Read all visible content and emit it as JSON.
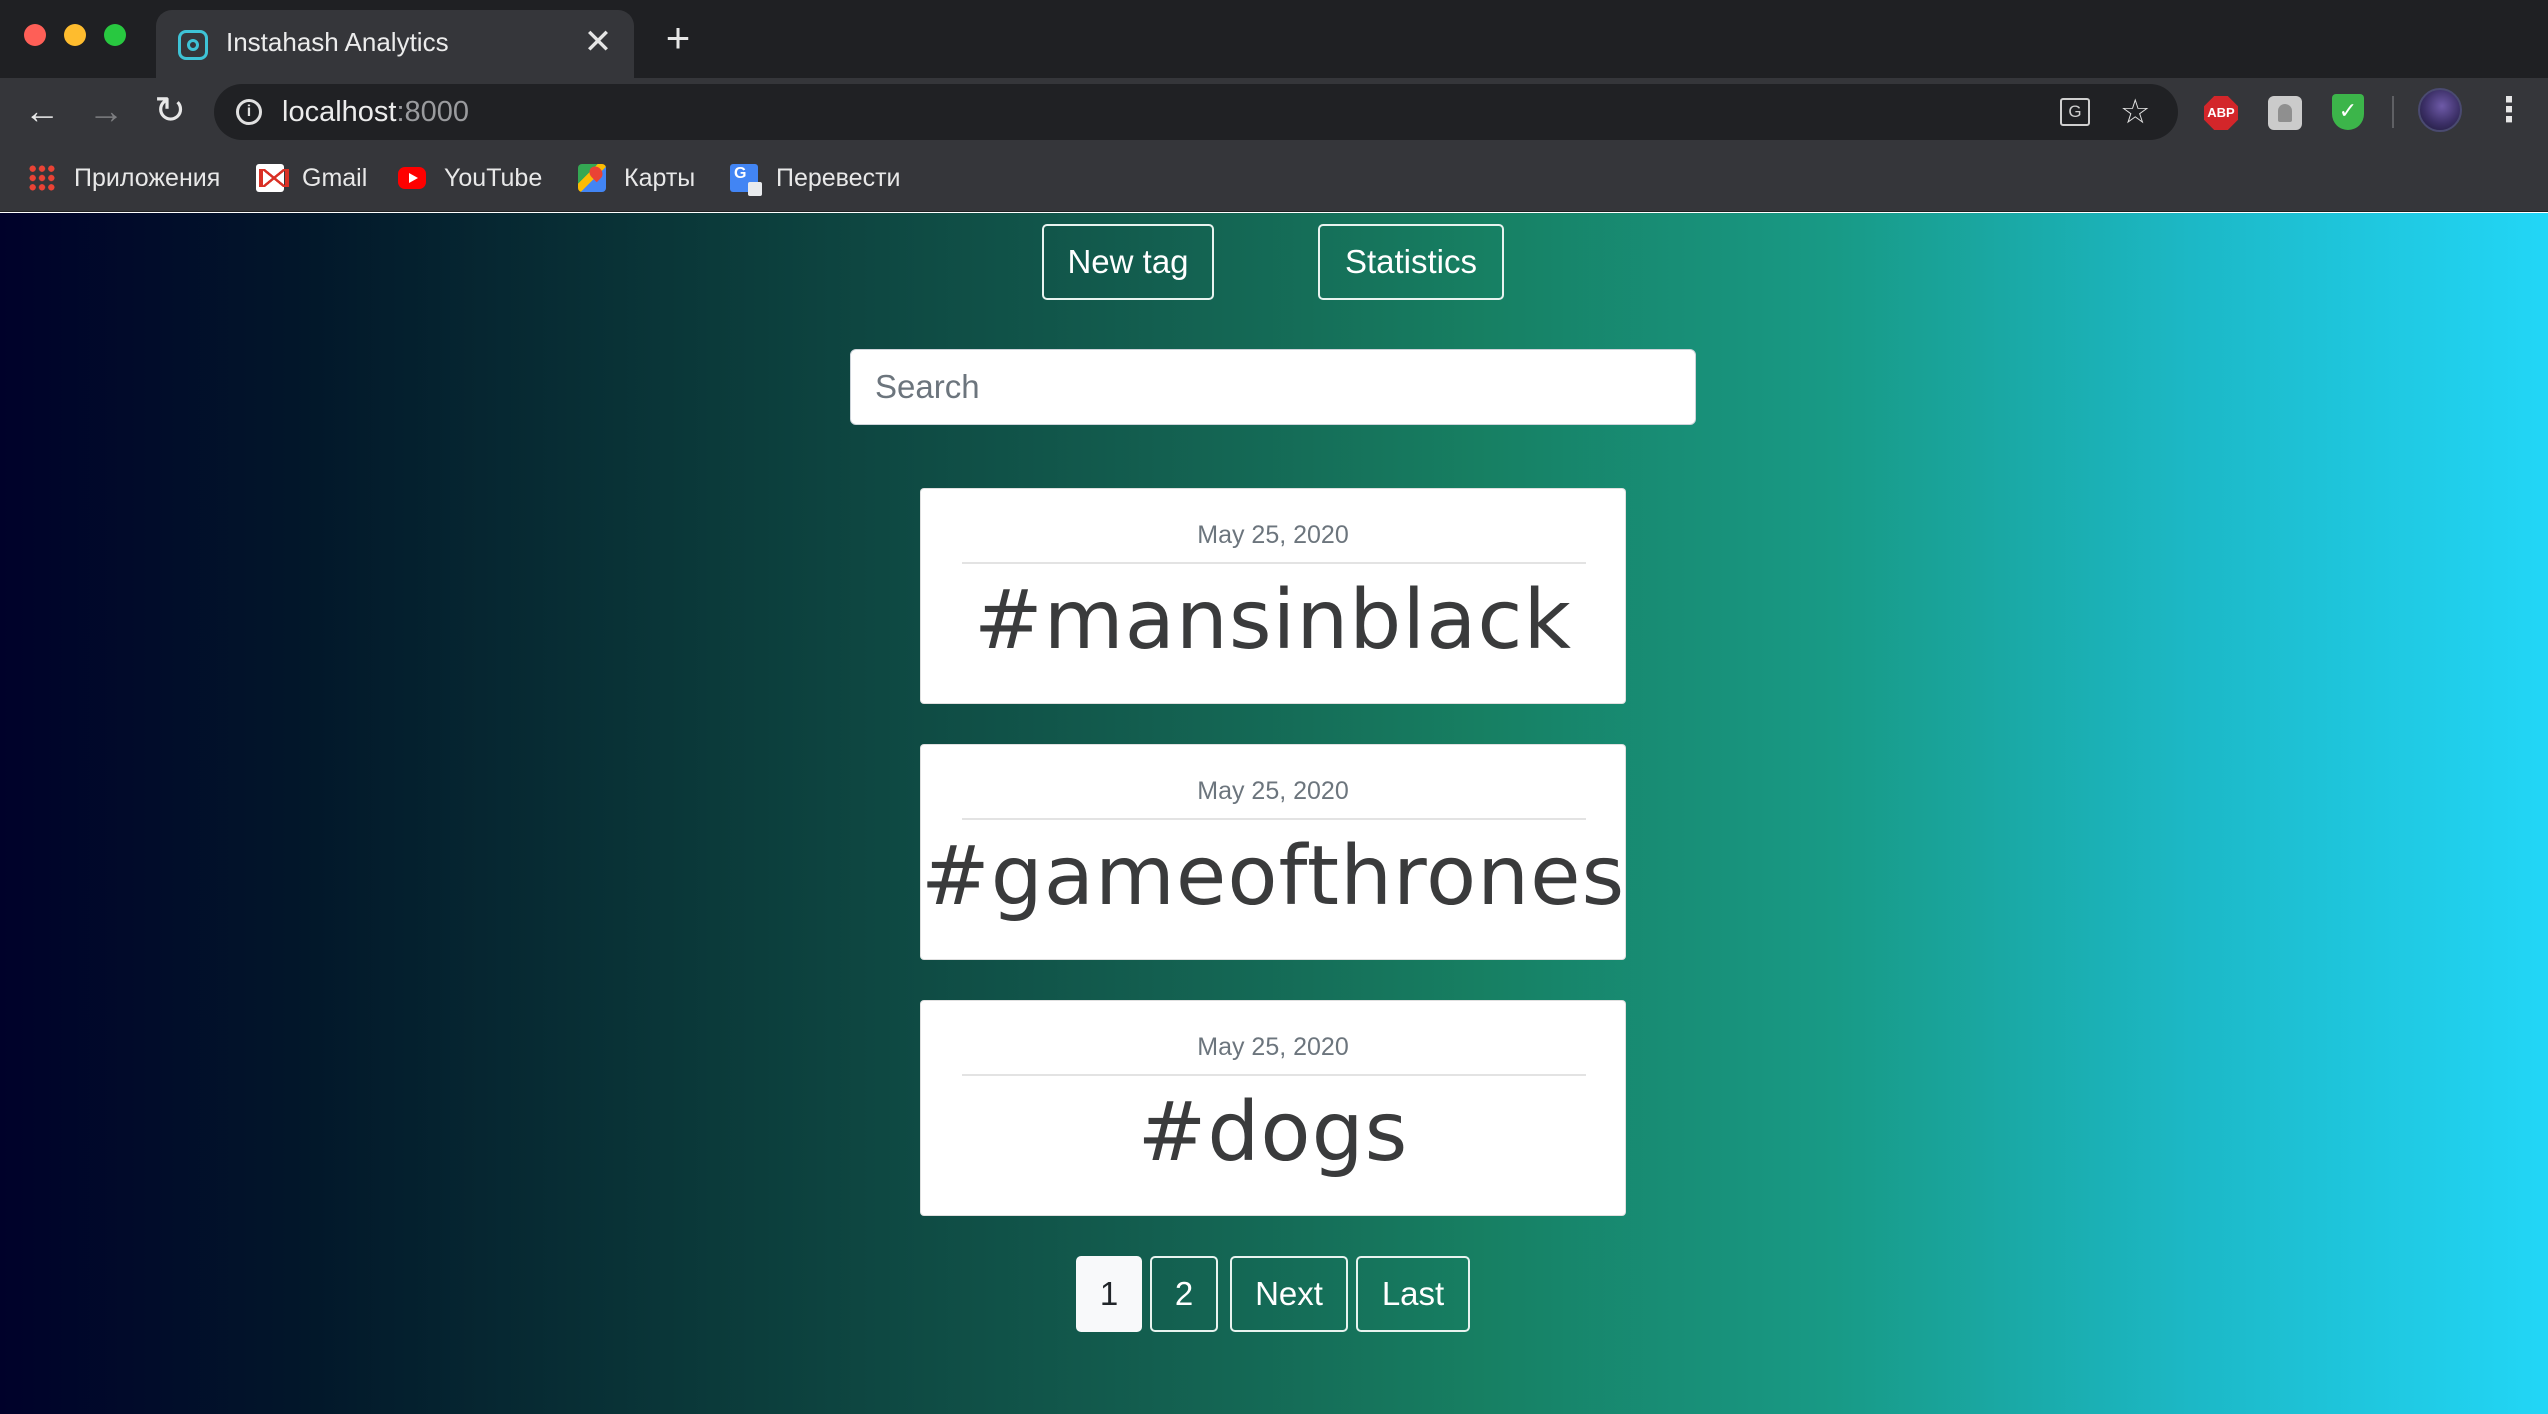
{
  "browser": {
    "tab_title": "Instahash Analytics",
    "tab_close_glyph": "✕",
    "new_tab_glyph": "+",
    "url_host": "localhost",
    "url_port": ":8000",
    "bookmarks": [
      {
        "label": "Приложения",
        "icon": "apps-grid-icon"
      },
      {
        "label": "Gmail",
        "icon": "gmail-icon"
      },
      {
        "label": "YouTube",
        "icon": "youtube-icon"
      },
      {
        "label": "Карты",
        "icon": "maps-icon"
      },
      {
        "label": "Перевести",
        "icon": "translate-icon"
      }
    ],
    "extensions": {
      "abp_label": "ABP"
    }
  },
  "page": {
    "new_tag_label": "New tag",
    "statistics_label": "Statistics",
    "search_placeholder": "Search",
    "cards": [
      {
        "date": "May 25, 2020",
        "tag": "#mansinblack"
      },
      {
        "date": "May 25, 2020",
        "tag": "#gameofthrones"
      },
      {
        "date": "May 25, 2020",
        "tag": "#dogs"
      }
    ],
    "pagination": {
      "pages": [
        "1",
        "2"
      ],
      "current": "1",
      "next_label": "Next",
      "last_label": "Last"
    }
  },
  "colors": {
    "gradient_start": "#00012a",
    "gradient_mid": "#177f62",
    "gradient_end": "#22d6f7"
  }
}
